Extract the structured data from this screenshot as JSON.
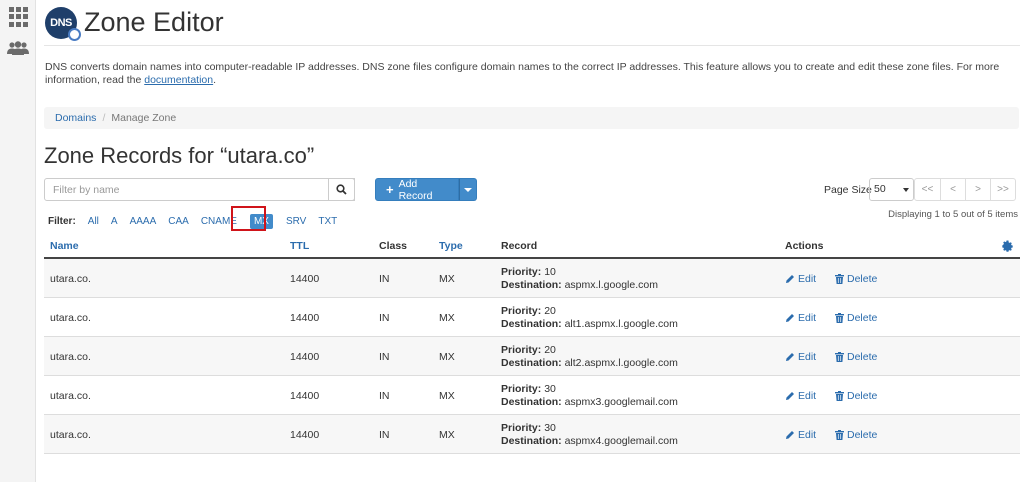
{
  "header": {
    "title": "Zone Editor",
    "logo_text": "DNS"
  },
  "description": {
    "text": "DNS converts domain names into computer-readable IP addresses. DNS zone files configure domain names to the correct IP addresses. This feature allows you to create and edit these zone files. For more information, read the ",
    "link": "documentation",
    "suffix": "."
  },
  "breadcrumb": {
    "root": "Domains",
    "sep": "/",
    "current": "Manage Zone"
  },
  "zone_title": "Zone Records for “utara.co”",
  "search": {
    "placeholder": "Filter by name",
    "value": ""
  },
  "add_record": {
    "label": "Add Record"
  },
  "page_size": {
    "label": "Page Size",
    "value": "50"
  },
  "pager": {
    "first": "<<",
    "prev": "<",
    "next": ">",
    "last": ">>"
  },
  "displaying": "Displaying 1 to 5 out of 5 items",
  "filter": {
    "label": "Filter:",
    "options": [
      "All",
      "A",
      "AAAA",
      "CAA",
      "CNAME",
      "MX",
      "SRV",
      "TXT"
    ],
    "active": "MX"
  },
  "table": {
    "headers": {
      "name": "Name",
      "ttl": "TTL",
      "class": "Class",
      "type": "Type",
      "record": "Record",
      "actions": "Actions"
    },
    "priority_label": "Priority:",
    "destination_label": "Destination:",
    "edit_label": "Edit",
    "delete_label": "Delete",
    "rows": [
      {
        "name": "utara.co.",
        "ttl": "14400",
        "class": "IN",
        "type": "MX",
        "priority": "10",
        "destination": "aspmx.l.google.com"
      },
      {
        "name": "utara.co.",
        "ttl": "14400",
        "class": "IN",
        "type": "MX",
        "priority": "20",
        "destination": "alt1.aspmx.l.google.com"
      },
      {
        "name": "utara.co.",
        "ttl": "14400",
        "class": "IN",
        "type": "MX",
        "priority": "20",
        "destination": "alt2.aspmx.l.google.com"
      },
      {
        "name": "utara.co.",
        "ttl": "14400",
        "class": "IN",
        "type": "MX",
        "priority": "30",
        "destination": "aspmx3.googlemail.com"
      },
      {
        "name": "utara.co.",
        "ttl": "14400",
        "class": "IN",
        "type": "MX",
        "priority": "30",
        "destination": "aspmx4.googlemail.com"
      }
    ]
  },
  "colors": {
    "link": "#2b6cad",
    "primary": "#428bca",
    "highlight": "#d0141a"
  }
}
